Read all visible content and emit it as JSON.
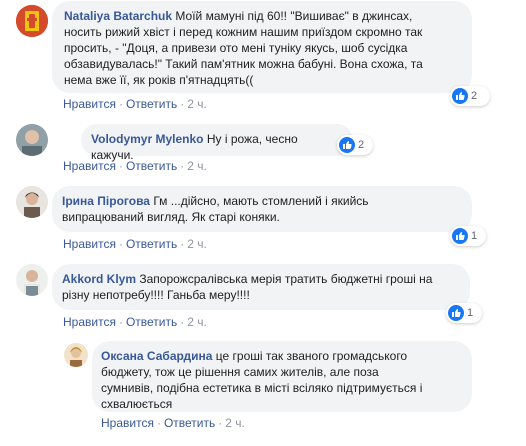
{
  "comments": [
    {
      "author": "Nataliya Batarchuk",
      "text_lines": [
        "Моїй мамуні під 60!! \"Вишиває\" в джинсах,",
        "носить рижий хвіст і перед кожним нашим приїздом скромно так",
        "просить, - \"Доця, а привези ото мені туніку якусь, шоб сусідка",
        "обзавидувалась!\" Такий пам'ятник можна бабуні. Вона схожа, та",
        "нема вже її, як років п'ятнадцять(("
      ],
      "like_action": "Нравится",
      "reply_action": "Ответить",
      "time": "2 ч.",
      "reaction_count": "2"
    },
    {
      "author": "Volodymyr Mylenko",
      "text": "Ну і рожа, чесно кажучи.",
      "like_action": "Нравится",
      "reply_action": "Ответить",
      "time": "2 ч.",
      "reaction_count": "2"
    },
    {
      "author": "Ірина Пірогова",
      "text_lines": [
        "Гм ...дійсно, мають стомлений і якийсь",
        "випрацюваний вигляд. Як старі коняки."
      ],
      "like_action": "Нравится",
      "reply_action": "Ответить",
      "time": "2 ч.",
      "reaction_count": "1"
    },
    {
      "author": "Akkord Klym",
      "text_lines": [
        "Запорожсралівська мерія тратить бюджетні гроші на",
        "різну непотребу!!!! Ганьба меру!!!!"
      ],
      "like_action": "Нравится",
      "reply_action": "Ответить",
      "time": "2 ч.",
      "reaction_count": "1"
    },
    {
      "author": "Оксана Сабардина",
      "text_lines": [
        "це гроші так званого громадського",
        "бюджету, тож це рішення самих жителів, але поза",
        "сумнивів, подібна естетика в місті всіляко підтримується і",
        "схвалюється"
      ],
      "like_action": "Нравится",
      "reply_action": "Ответить",
      "time": "2 ч."
    }
  ],
  "colors": {
    "link": "#385898",
    "bubble": "#f2f3f5",
    "like_blue": "#1877f2"
  }
}
